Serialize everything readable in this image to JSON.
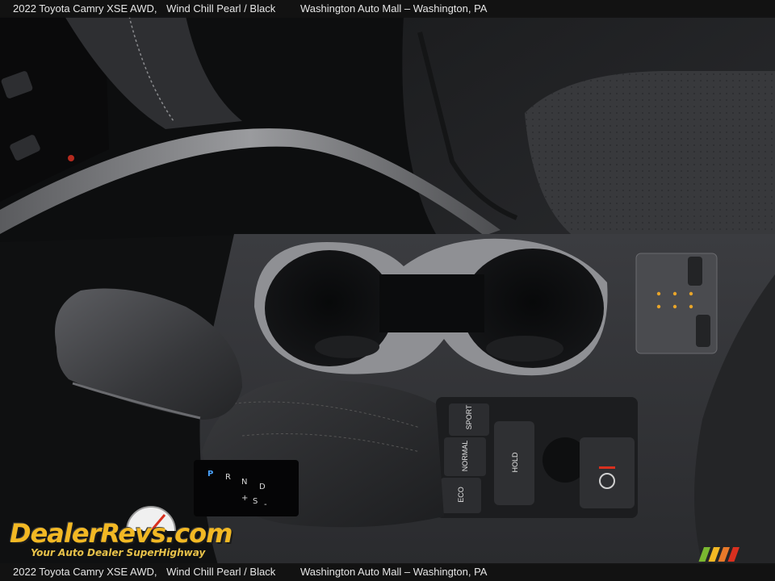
{
  "caption": {
    "title": "2022 Toyota Camry XSE AWD,",
    "color": "Wind Chill Pearl / Black",
    "dealer": "Washington Auto Mall – Washington, PA"
  },
  "console": {
    "drive_mode_buttons": [
      "SPORT",
      "NORMAL",
      "ECO"
    ],
    "auto_hold_label": "HOLD",
    "gear_labels": [
      "P",
      "R",
      "N",
      "D",
      "+",
      "S",
      "-"
    ]
  },
  "watermark": {
    "logo_text": "DealerRevs.com",
    "tagline": "Your Auto Dealer SuperHighway"
  },
  "colors": {
    "accent_gold": "#f2b824",
    "park_brake_red": "#d9301f",
    "seat_indicator_amber": "#e8a52a",
    "gear_blue": "#4aa3ff"
  }
}
